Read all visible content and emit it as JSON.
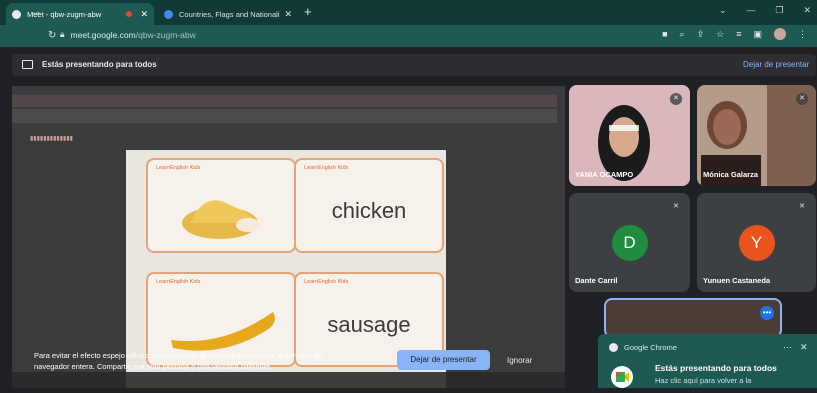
{
  "browser": {
    "tabs": [
      {
        "title": "Meet - qbw-zugm-abw",
        "close": "✕"
      },
      {
        "title": "Countries, Flags and Nationalities",
        "close": "✕"
      }
    ],
    "new_tab": "+",
    "url_domain": "meet.google.com",
    "url_path": "/qbw-zugm-abw"
  },
  "meet": {
    "presenting_text": "Estás presentando para todos",
    "stop_link": "Dejar de presentar",
    "hint": "Para evitar el efecto espejo infinito, no compartas la pantalla completa ni la ventana del navegador entera. Comparte una sola pestaña o una ventana diferente.",
    "stop_button": "Dejar de presentar",
    "ignore_button": "Ignorar"
  },
  "shared": {
    "cards": [
      {
        "brand": "LearnEnglish Kids",
        "word": ""
      },
      {
        "brand": "LearnEnglish Kids",
        "word": "chicken"
      },
      {
        "brand": "LearnEnglish Kids",
        "word": ""
      },
      {
        "brand": "LearnEnglish Kids",
        "word": "sausage"
      }
    ]
  },
  "participants": [
    {
      "name": "YANIA OCAMPO",
      "kind": "video",
      "color": "#c9a3a6"
    },
    {
      "name": "Mónica Galarza",
      "kind": "video",
      "color": "#8a6a5c"
    },
    {
      "name": "Dante Carril",
      "kind": "letter",
      "letter": "D",
      "color": "#1e8e3e"
    },
    {
      "name": "Yunuen Castaneda",
      "kind": "letter",
      "letter": "Y",
      "color": "#e8541c"
    }
  ],
  "notification": {
    "app": "Google Chrome",
    "title": "Estás presentando para todos",
    "text": "Haz clic aquí para volver a la"
  },
  "colors": {
    "accent": "#8ab4f8",
    "chrome_theme": "#1e5a53"
  }
}
